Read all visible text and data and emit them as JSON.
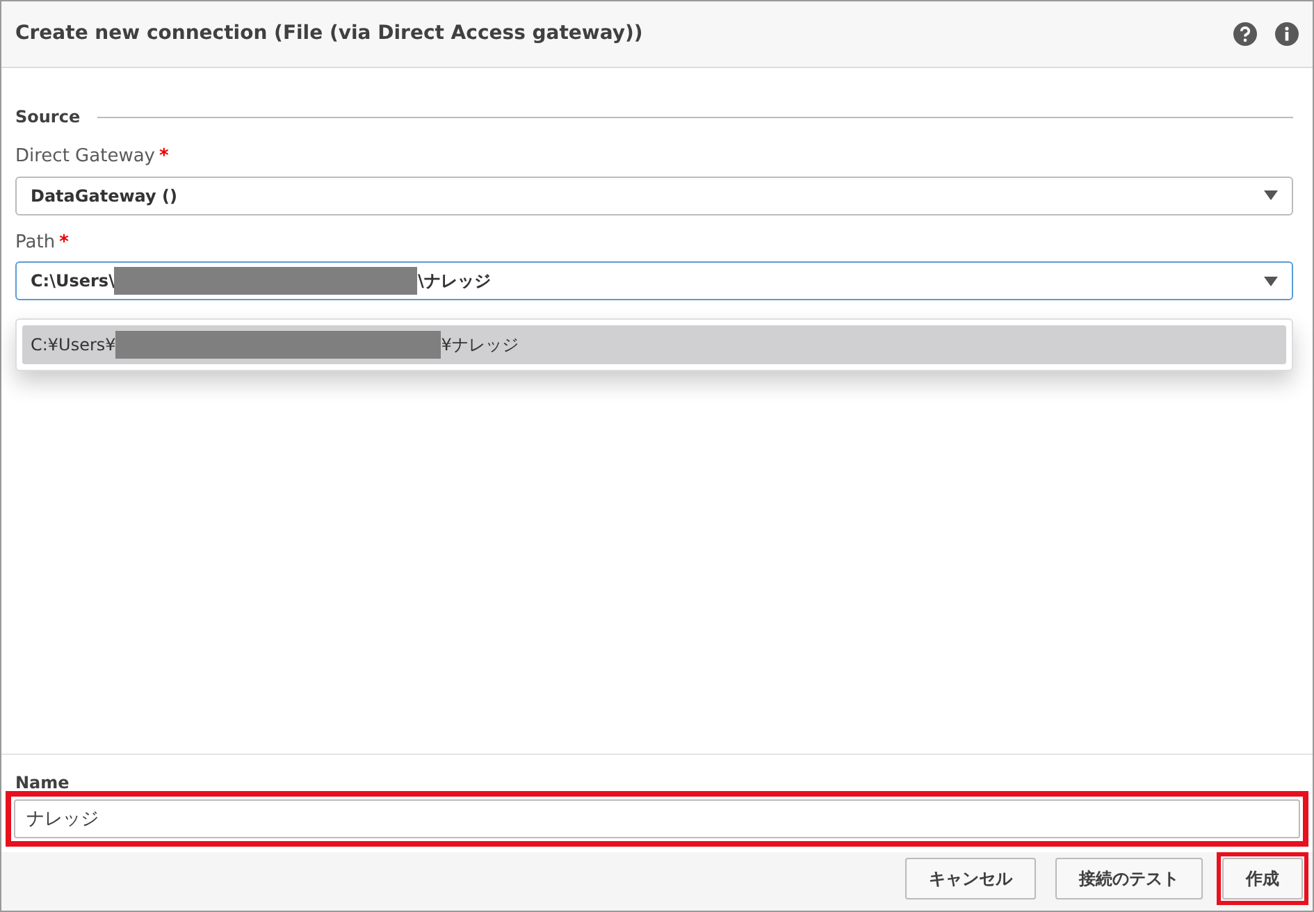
{
  "dialog": {
    "title": "Create new connection (File (via Direct Access gateway))"
  },
  "section": {
    "title": "Source"
  },
  "gateway": {
    "label": "Direct Gateway",
    "required": "*",
    "value": "DataGateway ()"
  },
  "path": {
    "label": "Path",
    "required": "*",
    "value_prefix": "C:\\Users\\",
    "redacted": true,
    "value_suffix": "\\ナレッジ",
    "focused": true
  },
  "suggestions": [
    {
      "prefix": "C:¥Users¥",
      "redacted": true,
      "suffix": "¥ナレッジ",
      "selected": true
    }
  ],
  "name": {
    "label": "Name",
    "value": "ナレッジ",
    "highlighted": true
  },
  "buttons": [
    {
      "label": "キャンセル",
      "highlighted": false
    },
    {
      "label": "接続のテスト",
      "highlighted": false
    },
    {
      "label": "作成",
      "highlighted": true
    }
  ]
}
